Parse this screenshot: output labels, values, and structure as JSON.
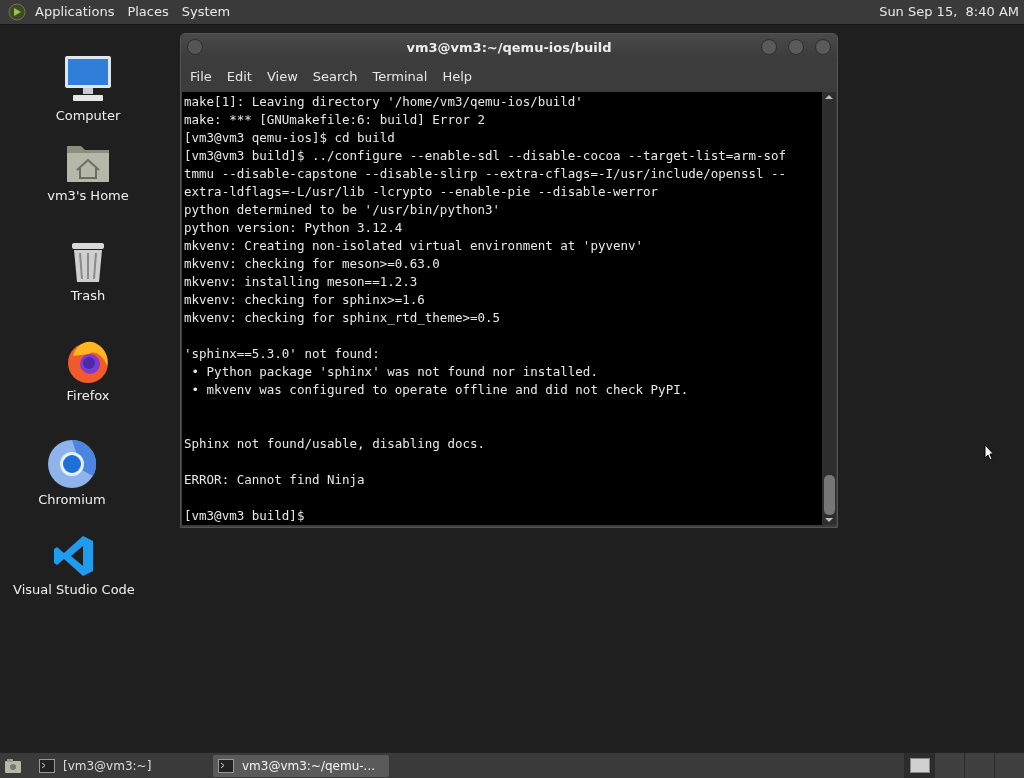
{
  "top_panel": {
    "menus": [
      "Applications",
      "Places",
      "System"
    ],
    "clock": "Sun Sep 15,  8:40 AM"
  },
  "desktop_icons": [
    {
      "kind": "computer",
      "label": "Computer"
    },
    {
      "kind": "home",
      "label": "vm3's Home"
    },
    {
      "kind": "trash",
      "label": "Trash"
    },
    {
      "kind": "firefox",
      "label": "Firefox"
    },
    {
      "kind": "chromium",
      "label": "Chromium"
    },
    {
      "kind": "vscode",
      "label": "Visual Studio Code"
    }
  ],
  "terminal": {
    "title": "vm3@vm3:~/qemu-ios/build",
    "menu": [
      "File",
      "Edit",
      "View",
      "Search",
      "Terminal",
      "Help"
    ],
    "blocks": [
      {
        "kind": "top",
        "lines": [
          "make[1]: Leaving directory '/home/vm3/qemu-ios/build'",
          "make: *** [GNUmakefile:6: build] Error 2",
          "[vm3@vm3 qemu-ios]$ cd build",
          "[vm3@vm3 build]$ ../configure --enable-sdl --disable-cocoa --target-list=arm-sof",
          "tmmu --disable-capstone --disable-slirp --extra-cflags=-I/usr/include/openssl --",
          "extra-ldflags=-L/usr/lib -lcrypto --enable-pie --disable-werror",
          "python determined to be '/usr/bin/python3'",
          "python version: Python 3.12.4",
          "mkvenv: Creating non-isolated virtual environment at 'pyvenv'",
          "mkvenv: checking for meson>=0.63.0",
          "mkvenv: installing meson==1.2.3",
          "mkvenv: checking for sphinx>=1.6",
          "mkvenv: checking for sphinx_rtd_theme>=0.5"
        ]
      },
      {
        "kind": "spaced",
        "lines": [
          "'sphinx==5.3.0' not found:",
          " • Python package 'sphinx' was not found nor installed.",
          " • mkvenv was configured to operate offline and did not check PyPI."
        ]
      },
      {
        "kind": "wide",
        "lines": [
          "Sphinx not found/usable, disabling docs."
        ]
      },
      {
        "kind": "spaced",
        "lines": [
          "ERROR: Cannot find Ninja"
        ]
      },
      {
        "kind": "spaced",
        "lines": [
          "[vm3@vm3 build]$"
        ]
      }
    ]
  },
  "taskbar": {
    "tasks": [
      {
        "label": "[vm3@vm3:~]",
        "selected": false
      },
      {
        "label": "vm3@vm3:~/qemu-...",
        "selected": true
      }
    ],
    "workspaces": [
      {
        "selected": true
      },
      {
        "selected": false
      },
      {
        "selected": false
      },
      {
        "selected": false
      }
    ]
  }
}
